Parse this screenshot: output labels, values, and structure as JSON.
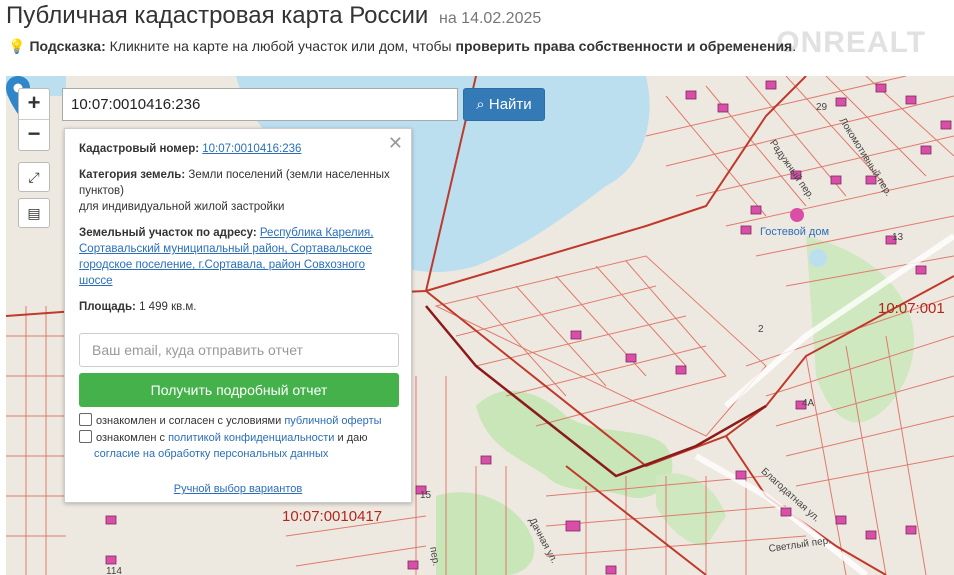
{
  "header": {
    "title": "Публичная кадастровая карта России",
    "date": "на 14.02.2025",
    "watermark": "ONREALT"
  },
  "hint": {
    "label": "Подсказка:",
    "text": "Кликните на карте на любой участок или дом, чтобы",
    "bold_text": "проверить права собственности и обременения",
    "end": "."
  },
  "search": {
    "value": "10:07:0010416:236",
    "button": "Найти"
  },
  "map_controls": {
    "zoom_in": "+",
    "zoom_out": "−"
  },
  "popup": {
    "cad_label": "Кадастровый номер:",
    "cad_value": "10:07:0010416:236",
    "category_label": "Категория земель:",
    "category_value": "Земли поселений (земли населенных пунктов)",
    "category_use": "для индивидуальной жилой застройки",
    "address_label": "Земельный участок по адресу:",
    "address_value": "Республика Карелия, Сортавальский муниципальный район, Сортавальское городское поселение, г.Сортавала, район Совхозного шоссе",
    "area_label": "Площадь:",
    "area_value": "1 499 кв.м.",
    "email_placeholder": "Ваш email, куда отправить отчет",
    "report_button": "Получить подробный отчет",
    "agree1_prefix": "ознакомлен и согласен с условиями",
    "agree1_link": "публичной оферты",
    "agree2_prefix": "ознакомлен с",
    "agree2_link": "политикой конфиденциальности",
    "agree2_mid": "и даю",
    "agree2_link2": "согласие на обработку персональных данных",
    "manual_link": "Ручной выбор вариантов"
  },
  "map_labels": {
    "quarter_main": "10:07:0010417",
    "quarter_right": "10:07:001",
    "poi": "Гостевой дом",
    "street_lokomotiv": "Локомотивный пер.",
    "street_raduzhny": "Радужный пер.",
    "street_blagodatnaya": "Благодатная ул.",
    "street_svetly": "Светлый пер.",
    "street_dachnaya": "Дачная ул.",
    "street_per": "пер.",
    "num_29": "29",
    "num_2": "2",
    "num_4a": "4А",
    "num_114": "114",
    "num_13": "13",
    "num_15": "15"
  }
}
